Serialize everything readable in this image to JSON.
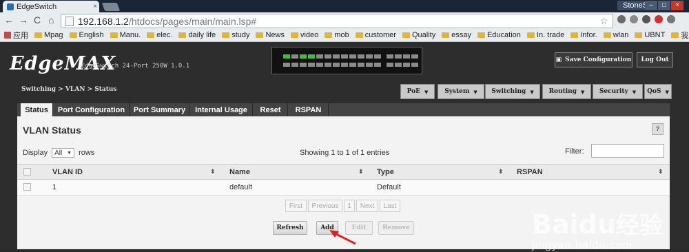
{
  "browser": {
    "tab_title": "EdgeSwitch",
    "tab_close": "×",
    "user": "StoneS",
    "win_min": "–",
    "win_max": "□",
    "win_close": "×",
    "url_host": "192.168.1.2",
    "url_path": "/htdocs/pages/main/main.lsp#",
    "bookmarks": [
      "应用",
      "Mpag",
      "English",
      "Manu.",
      "elec.",
      "daily life",
      "study",
      "News",
      "video",
      "mob",
      "customer",
      "Quality",
      "essay",
      "Education",
      "In. trade",
      "Infor.",
      "wlan",
      "UBNT",
      "我的贴子"
    ]
  },
  "header": {
    "logo": "EdgeMAX",
    "model": "EdgeSwitch 24-Port 250W 1.0.1",
    "save_config": "Save Configuration",
    "logout": "Log Out"
  },
  "breadcrumb": "Switching > VLAN > Status",
  "menu": [
    "PoE",
    "System",
    "Switching",
    "Routing",
    "Security",
    "QoS"
  ],
  "tabs": [
    "Status",
    "Port Configuration",
    "Port Summary",
    "Internal Usage",
    "Reset",
    "RSPAN"
  ],
  "panel": {
    "title": "VLAN Status",
    "help": "?",
    "display_label": "Display",
    "display_value": "All",
    "rows_label": "rows",
    "showing": "Showing 1 to 1 of 1 entries",
    "filter_label": "Filter:",
    "filter_value": ""
  },
  "table": {
    "columns": [
      "VLAN ID",
      "Name",
      "Type",
      "RSPAN"
    ],
    "rows": [
      {
        "vlan_id": "1",
        "name": "default",
        "type": "Default",
        "rspan": ""
      }
    ]
  },
  "pagination": [
    "First",
    "Previous",
    "1",
    "Next",
    "Last"
  ],
  "actions": [
    "Refresh",
    "Add",
    "Edit",
    "Remove"
  ],
  "watermark": {
    "brand": "Baidu",
    "cn": "经验",
    "url": "jingyan.baidu.com"
  },
  "colors": {
    "accent_arrow": "#e0201d",
    "port_active": "#3fbf3f"
  }
}
